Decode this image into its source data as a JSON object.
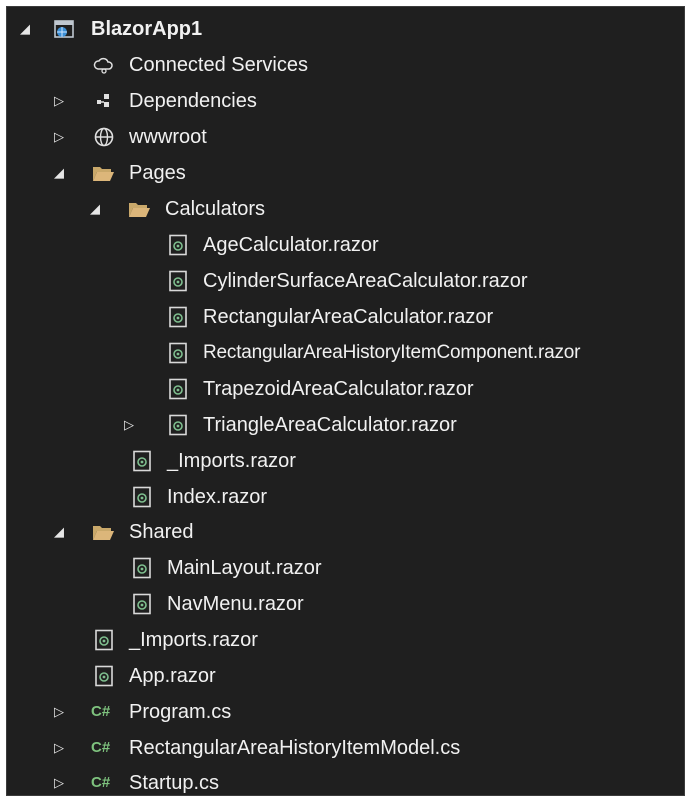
{
  "tree": {
    "project": {
      "label": "BlazorApp1",
      "icon": "web-project-icon",
      "expanded": true
    },
    "connected_services": {
      "label": "Connected Services",
      "icon": "connected-services-icon"
    },
    "dependencies": {
      "label": "Dependencies",
      "icon": "dependencies-icon",
      "expanded": false
    },
    "wwwroot": {
      "label": "wwwroot",
      "icon": "globe-icon",
      "expanded": false
    },
    "pages": {
      "label": "Pages",
      "icon": "folder-open-icon",
      "expanded": true
    },
    "calculators": {
      "label": "Calculators",
      "icon": "folder-open-icon",
      "expanded": true
    },
    "age_calculator": {
      "label": "AgeCalculator.razor",
      "icon": "razor-file-icon"
    },
    "cylinder_calculator": {
      "label": "CylinderSurfaceAreaCalculator.razor",
      "icon": "razor-file-icon"
    },
    "rectangular_calculator": {
      "label": "RectangularAreaCalculator.razor",
      "icon": "razor-file-icon"
    },
    "rectangular_history_component": {
      "label": "RectangularAreaHistoryItemComponent.razor",
      "icon": "razor-file-icon"
    },
    "trapezoid_calculator": {
      "label": "TrapezoidAreaCalculator.razor",
      "icon": "razor-file-icon"
    },
    "triangle_calculator": {
      "label": "TriangleAreaCalculator.razor",
      "icon": "razor-file-icon",
      "expanded": false
    },
    "pages_imports": {
      "label": "_Imports.razor",
      "icon": "razor-file-icon"
    },
    "index": {
      "label": "Index.razor",
      "icon": "razor-file-icon"
    },
    "shared": {
      "label": "Shared",
      "icon": "folder-open-icon",
      "expanded": true
    },
    "main_layout": {
      "label": "MainLayout.razor",
      "icon": "razor-file-icon"
    },
    "nav_menu": {
      "label": "NavMenu.razor",
      "icon": "razor-file-icon"
    },
    "root_imports": {
      "label": "_Imports.razor",
      "icon": "razor-file-icon"
    },
    "app": {
      "label": "App.razor",
      "icon": "razor-file-icon"
    },
    "program": {
      "label": "Program.cs",
      "icon": "csharp-file-icon",
      "expanded": false
    },
    "history_model": {
      "label": "RectangularAreaHistoryItemModel.cs",
      "icon": "csharp-file-icon",
      "expanded": false
    },
    "startup": {
      "label": "Startup.cs",
      "icon": "csharp-file-icon",
      "expanded": false
    }
  },
  "glyphs": {
    "expanded": "◢",
    "collapsed": "▷",
    "csharp": "C#"
  },
  "colors": {
    "background": "#1f1f1f",
    "text": "#f1f1f1",
    "folder": "#dcb67a",
    "razor_icon_border": "#d9d9d9",
    "razor_icon_mark": "#7fbf8f",
    "csharp": "#7ec27e",
    "web_project": "#3b8fd6"
  }
}
